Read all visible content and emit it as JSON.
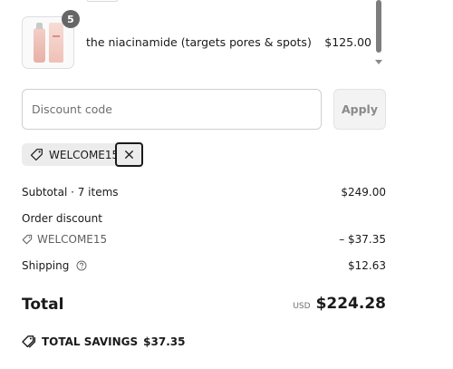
{
  "line_item": {
    "quantity": "5",
    "name": "the niacinamide (targets pores & spots)",
    "price": "$125.00"
  },
  "discount": {
    "placeholder": "Discount code",
    "apply_label": "Apply"
  },
  "applied_code": {
    "code": "WELCOME15"
  },
  "summary": {
    "subtotal_label": "Subtotal · 7 items",
    "subtotal_value": "$249.00",
    "order_discount_label": "Order discount",
    "discount_code": "WELCOME15",
    "discount_value": "– $37.35",
    "shipping_label": "Shipping",
    "shipping_value": "$12.63",
    "total_label": "Total",
    "total_currency": "USD",
    "total_value": "$224.28",
    "savings_label": "TOTAL SAVINGS",
    "savings_value": "$37.35"
  },
  "icons": {
    "tag": "tag-icon",
    "close": "close-icon",
    "help": "help-circle-icon",
    "savings": "double-tag-icon"
  }
}
